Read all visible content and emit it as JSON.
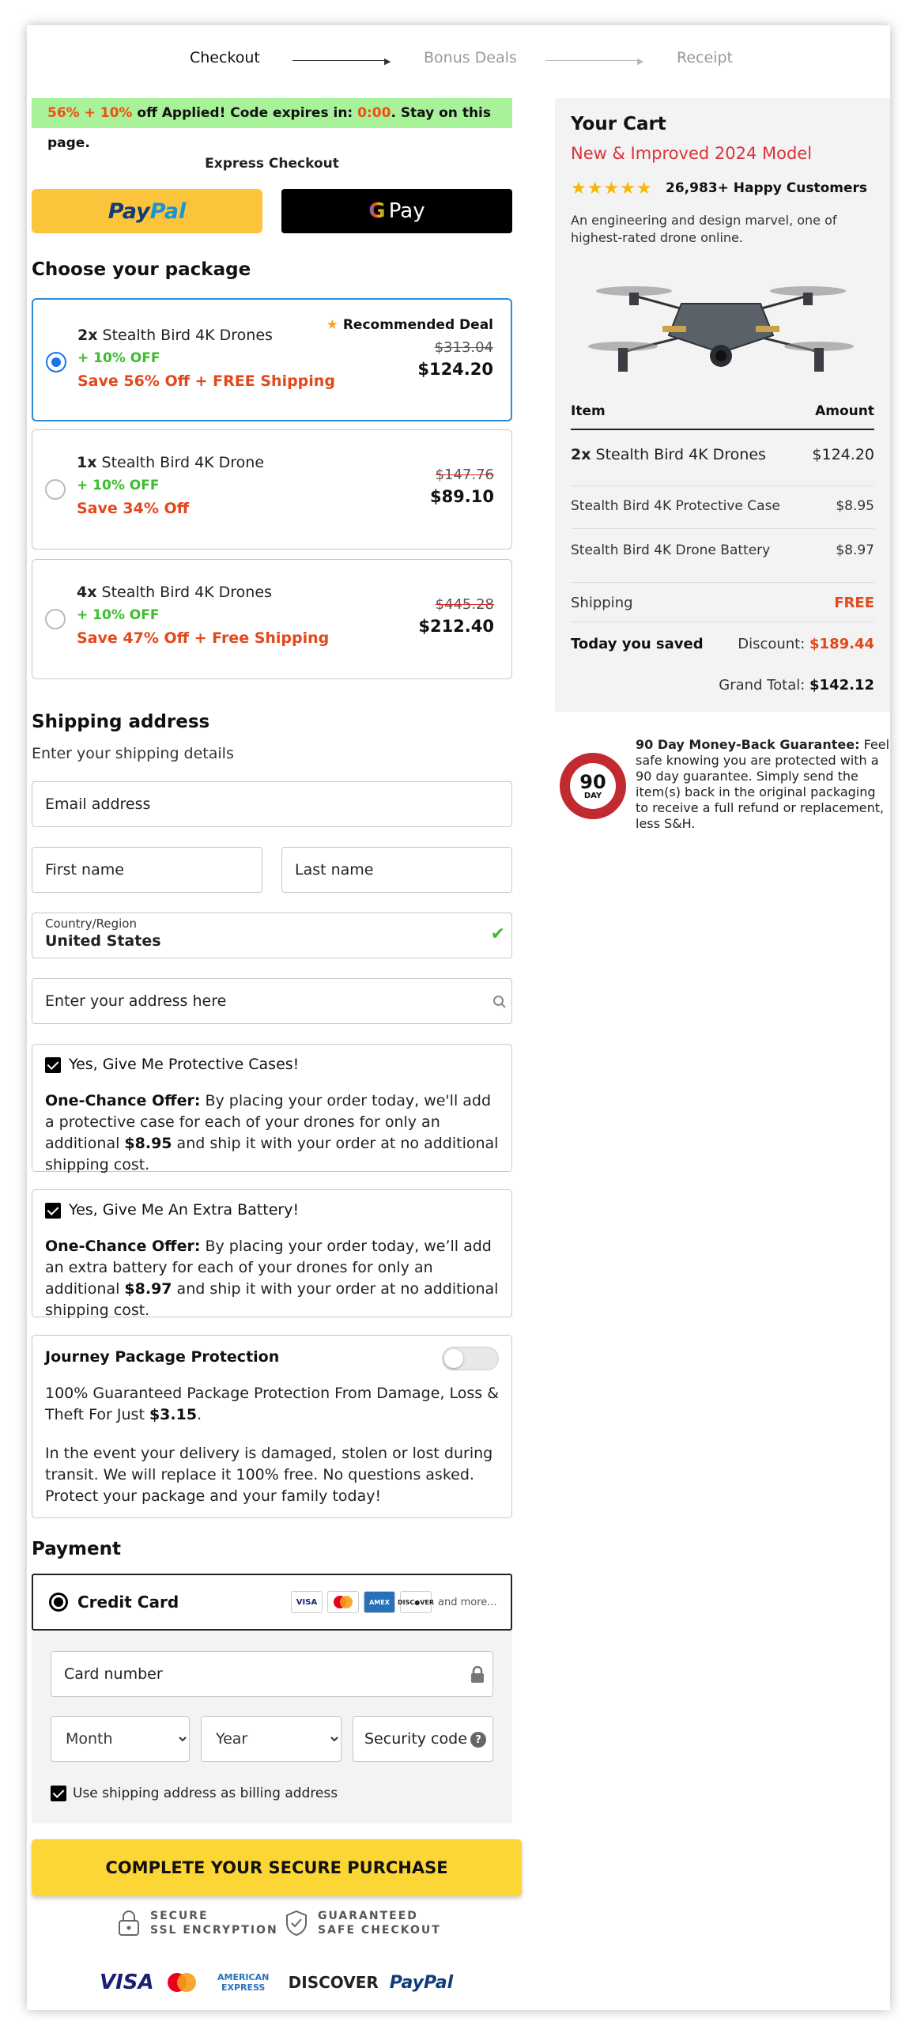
{
  "steps": [
    "Checkout",
    "Bonus Deals",
    "Receipt"
  ],
  "promo": {
    "discount": "56% + 10%",
    "text1": " off Applied! Code expires in: ",
    "timer": "0:00",
    "text2": ". Stay on this page."
  },
  "express": {
    "title": "Express Checkout",
    "paypal_a": "Pay",
    "paypal_b": "Pal",
    "gpay": "Pay"
  },
  "package_title": "Choose your package",
  "packages": [
    {
      "qty": "2x",
      "name": " Stealth Bird 4K Drones",
      "off": "+ 10% OFF",
      "save": "Save 56% Off + FREE Shipping",
      "old_price": "$313.04",
      "price": "$124.20",
      "badge": "Recommended Deal",
      "selected": true
    },
    {
      "qty": "1x",
      "name": " Stealth Bird 4K Drone",
      "off": "+ 10% OFF",
      "save": "Save 34% Off",
      "old_price": "$147.76",
      "price": "$89.10",
      "selected": false
    },
    {
      "qty": "4x",
      "name": " Stealth Bird 4K Drones",
      "off": "+ 10% OFF",
      "save": "Save 47% Off + Free Shipping",
      "old_price": "$445.28",
      "price": "$212.40",
      "selected": false
    }
  ],
  "shipping": {
    "title": "Shipping address",
    "subtitle": "Enter your shipping details",
    "email": "Email address",
    "first": "First name",
    "last": "Last name",
    "country_label": "Country/Region",
    "country": "United States",
    "address": "Enter your address here"
  },
  "offers": [
    {
      "title": "Yes, Give Me Protective Cases!",
      "lead": "One-Chance Offer:",
      "text": " By placing your order today, we'll add a protective case for each of your drones for only an additional ",
      "price": "$8.95",
      "tail": " and ship it with your order at no additional shipping cost."
    },
    {
      "title": "Yes, Give Me An Extra Battery!",
      "lead": "One-Chance Offer:",
      "text": " By placing your order today, we’ll add an extra battery for each of your drones for only an additional ",
      "price": "$8.97",
      "tail": " and ship it with your order at no additional shipping cost."
    }
  ],
  "protection": {
    "title": "Journey Package Protection",
    "text1": "100% Guaranteed Package Protection From Damage, Loss & Theft For Just ",
    "price": "$3.15",
    "text1_end": ".",
    "text2": "In the event your delivery is damaged, stolen or lost during transit. We will replace it 100% free. No questions asked. Protect your package and your family today!"
  },
  "payment": {
    "title": "Payment",
    "method": "Credit Card",
    "more": "and more...",
    "card_number": "Card number",
    "month": "Month",
    "year": "Year",
    "cvv": "Security code",
    "billing": "Use shipping address as billing address",
    "cta": "COMPLETE YOUR SECURE PURCHASE",
    "ssl_1": "SECURE",
    "ssl_2": "SSL ENCRYPTION",
    "safe_1": "GUARANTEED",
    "safe_2": "SAFE CHECKOUT",
    "brands": [
      "VISA",
      "AMERICAN EXPRESS",
      "DISCOVER",
      "PayPal"
    ]
  },
  "cart": {
    "title": "Your Cart",
    "subtitle": "New & Improved 2024 Model",
    "stars": "★★★★★",
    "happy": "26,983+ Happy Customers",
    "desc": "An engineering and design marvel, one of highest-rated drone online.",
    "col_item": "Item",
    "col_amount": "Amount",
    "lines": [
      {
        "qty": "2x",
        "item": " Stealth Bird 4K Drones",
        "amount": "$124.20"
      },
      {
        "qty": "",
        "item": "Stealth Bird 4K Protective Case",
        "amount": "$8.95"
      },
      {
        "qty": "",
        "item": "Stealth Bird 4K Drone Battery",
        "amount": "$8.97"
      }
    ],
    "shipping_label": "Shipping",
    "shipping_value": "FREE",
    "saved_label": "Today you saved",
    "discount_label": "Discount: ",
    "discount_value": "$189.44",
    "total_label": "Grand Total: ",
    "total_value": "$142.12"
  },
  "guarantee": {
    "lead": "90 Day Money-Back Guarantee:",
    "text": " Feel safe knowing you are protected with a 90 day guarantee. Simply send the item(s) back in the original packaging to receive a full refund or replacement, less S&H.",
    "seal_num": "90",
    "seal_day": "DAY"
  },
  "colors": {
    "accent": "#fcd635",
    "promo_bg": "#a8f29a",
    "sale": "#e2481b",
    "green": "#3bbd2c",
    "selected_border": "#2d8cd6"
  }
}
